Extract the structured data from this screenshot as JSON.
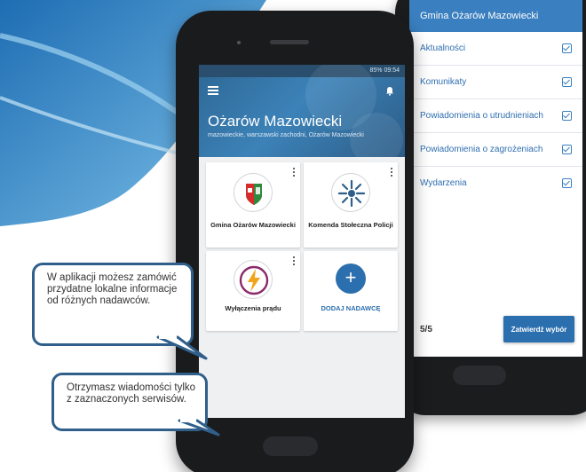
{
  "back_phone": {
    "header": "Gmina Ożarów Mazowiecki",
    "services": [
      {
        "label": "Aktualności",
        "checked": true
      },
      {
        "label": "Komunikaty",
        "checked": true
      },
      {
        "label": "Powiadomienia o utrudnieniach",
        "checked": true
      },
      {
        "label": "Powiadomienia o zagrożeniach",
        "checked": true
      },
      {
        "label": "Wydarzenia",
        "checked": true
      }
    ],
    "page_count": "5/5",
    "confirm_label": "Zatwierdź wybór"
  },
  "front_phone": {
    "status": "85% 09:54",
    "city": "Ożarów Mazowiecki",
    "location": "mazowieckie, warszawski zachodni, Ożarów Mazowiecki",
    "cards": [
      {
        "label": "Gmina Ożarów Mazowiecki",
        "icon": "coat-of-arms-icon"
      },
      {
        "label": "Komenda Stołeczna Policji",
        "icon": "police-star-icon"
      },
      {
        "label": "Wyłączenia prądu",
        "icon": "lightning-icon"
      }
    ],
    "add_symbol": "+",
    "add_label": "DODAJ NADAWCĘ"
  },
  "callouts": {
    "first": "W aplikacji możesz zamówić przydatne lokalne informacje od różnych nadawców.",
    "second": "Otrzymasz wiadomości tylko z zaznaczonych serwisów."
  },
  "colors": {
    "accent": "#2b6fae",
    "callout_border": "#2f5f8a",
    "wave": "#2f86c6"
  }
}
